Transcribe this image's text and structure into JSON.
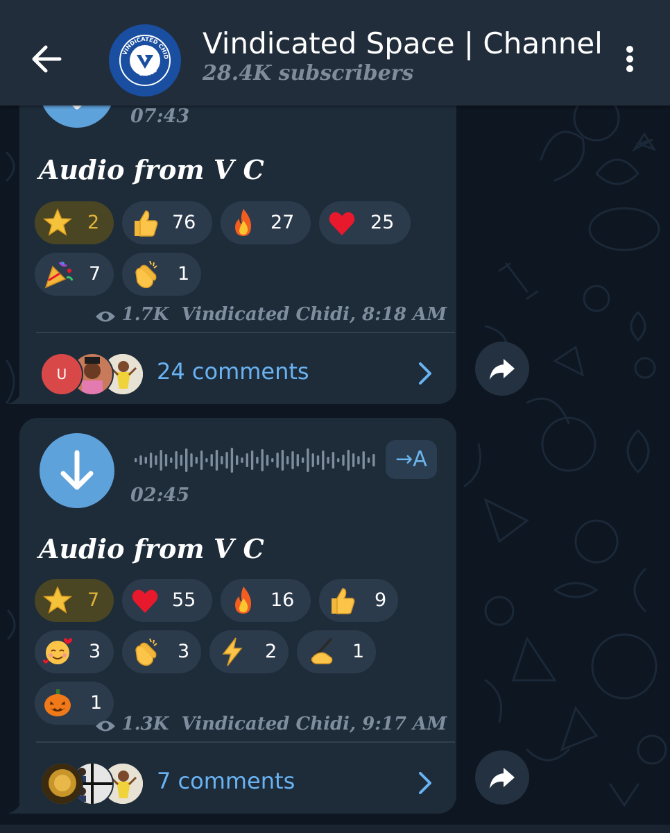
{
  "header": {
    "title": "Vindicated Space | Channel",
    "subscribers": "28.4K subscribers",
    "avatar_text_top": "VINDICATED CHIDI",
    "avatar_text_bottom": "SPACE"
  },
  "messages": [
    {
      "duration": "07:43",
      "caption": "Audio from V C",
      "reactions": [
        {
          "emoji": "star",
          "count": "2"
        },
        {
          "emoji": "thumbs-up",
          "count": "76"
        },
        {
          "emoji": "fire",
          "count": "27"
        },
        {
          "emoji": "heart",
          "count": "25"
        },
        {
          "emoji": "party-popper",
          "count": "7"
        },
        {
          "emoji": "clapping-hands",
          "count": "1"
        }
      ],
      "views": "1.7K",
      "author_time": "Vindicated Chidi, 8:18 AM",
      "comment_avatar_initial": "U",
      "comments": "24 comments"
    },
    {
      "duration": "02:45",
      "transcribe_label": "→A",
      "caption": "Audio from V C",
      "reactions": [
        {
          "emoji": "star",
          "count": "7"
        },
        {
          "emoji": "heart",
          "count": "55"
        },
        {
          "emoji": "fire",
          "count": "16"
        },
        {
          "emoji": "thumbs-up",
          "count": "9"
        },
        {
          "emoji": "smiling-face-with-hearts",
          "count": "3"
        },
        {
          "emoji": "clapping-hands",
          "count": "3"
        },
        {
          "emoji": "high-voltage",
          "count": "2"
        },
        {
          "emoji": "writing-hand",
          "count": "1"
        },
        {
          "emoji": "jack-o-lantern",
          "count": "1"
        }
      ],
      "views": "1.3K",
      "author_time": "Vindicated Chidi, 9:17 AM",
      "comments": "7 comments"
    }
  ],
  "colors": {
    "background": "#0e1621",
    "header": "#212d3b",
    "bubble": "#1e2c3a",
    "accent": "#6ab3f3",
    "play_button": "#5ea2dc",
    "star_reaction": "#e3b43b"
  }
}
